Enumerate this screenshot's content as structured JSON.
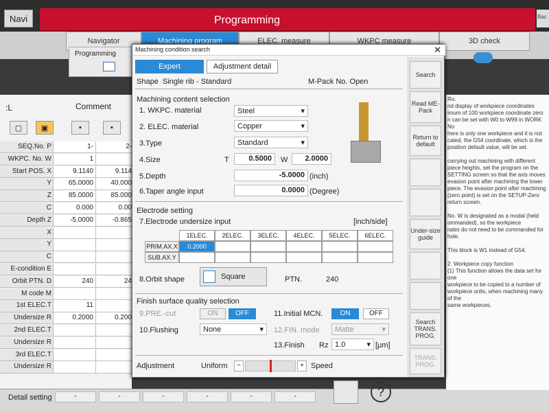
{
  "topbar": {
    "navi": "Navi",
    "title": "Programming",
    "right_stub": "Bac"
  },
  "tabs": [
    "Navigator",
    "Machining program",
    "ELEC. measure",
    "WKPC measure",
    "3D check"
  ],
  "prog_box": "Programming",
  "left": {
    "l_label": ":L",
    "comment": "Comment",
    "rows": [
      {
        "lab": "SEQ.No. P",
        "c1": "1-",
        "c2": "2-"
      },
      {
        "lab": "WKPC. No. W",
        "c1": "1",
        "c2": ""
      },
      {
        "lab": "Start POS. X",
        "c1": "9.1140",
        "c2": "9.114"
      },
      {
        "lab": "Y",
        "c1": "65.0000",
        "c2": "40.000"
      },
      {
        "lab": "Z",
        "c1": "85.0000",
        "c2": "85.000"
      },
      {
        "lab": "C",
        "c1": "0.000",
        "c2": "0.00"
      },
      {
        "lab": "Depth  Z",
        "c1": "-5.0000",
        "c2": "-0.865"
      },
      {
        "lab": "X",
        "c1": "",
        "c2": ""
      },
      {
        "lab": "Y",
        "c1": "",
        "c2": ""
      },
      {
        "lab": "C",
        "c1": "",
        "c2": ""
      },
      {
        "lab": "E-condition E",
        "c1": "",
        "c2": ""
      },
      {
        "lab": "Orbit PTN. D",
        "c1": "240",
        "c2": "24"
      },
      {
        "lab": "M code  M",
        "c1": "",
        "c2": ""
      },
      {
        "lab": "1st ELEC.T",
        "c1": "11",
        "c2": ""
      },
      {
        "lab": "Undersize R",
        "c1": "0.2000",
        "c2": "0.200"
      },
      {
        "lab": "2nd ELEC.T",
        "c1": "",
        "c2": ""
      },
      {
        "lab": "Undersize R",
        "c1": "",
        "c2": ""
      },
      {
        "lab": "3rd ELEC.T",
        "c1": "",
        "c2": ""
      },
      {
        "lab": "Undersize R",
        "c1": "",
        "c2": ""
      }
    ],
    "detail": "Detail setting"
  },
  "dialog": {
    "title": "Machining condition search",
    "tab_expert": "Expert",
    "tab_adjust": "Adjustment detail",
    "shape_label": "Shape",
    "shape_value": "Single rib - Standard",
    "mpack": "M-Pack No. Open",
    "mcs_title": "Machining content selection",
    "wkpc_label": "1. WKPC. material",
    "wkpc_value": "Steel",
    "elec_label": "2. ELEC. material",
    "elec_value": "Copper",
    "type_label": "3.Type",
    "type_value": "Standard",
    "size_label": "4.Size",
    "t_label": "T",
    "t_value": "0.5000",
    "w_label": "W",
    "w_value": "2.0000",
    "depth_label": "5.Depth",
    "depth_value": "-5.0000",
    "depth_unit": "(inch)",
    "taper_label": "6.Taper angle input",
    "taper_value": "0.0000",
    "taper_unit": "(Degree)",
    "es_title": "Electrode setting",
    "eu_label": "7.Electrode undersize input",
    "eu_unit": "[inch/side]",
    "elec_cols": [
      "1ELEC.",
      "2ELEC.",
      "3ELEC.",
      "4ELEC.",
      "5ELEC.",
      "6ELEC."
    ],
    "prim_label": "PRIM.AX.X",
    "prim_val": "0.2000",
    "sub_label": "SUB.AX.Y",
    "orbit_label": "8.Orbit shape",
    "orbit_btn": "Square",
    "ptn_label": "PTN.",
    "ptn_value": "240",
    "fsq_title": "Finish surface quality selection",
    "pre_label": "9.PRE.-cut",
    "on": "ON",
    "off": "OFF",
    "init_label": "11.Initial MCN.",
    "flush_label": "10.Flushing",
    "flush_value": "None",
    "finmode_label": "12.FIN. mode",
    "finmode_value": "Matte",
    "finish_label": "13.Finish",
    "rz": "Rz",
    "finish_value": "1.0",
    "finish_unit": "[μm]",
    "adj_label": "Adjustment",
    "adj_mode": "Uniform",
    "adj_speed": "Speed",
    "minus": "−",
    "plus": "+",
    "side": {
      "search": "Search",
      "read": "Read ME-Pack",
      "return": "Return to default",
      "undersize": "Under-size guide",
      "search_trans": "Search TRANS. PROG.",
      "trans": "TRANS. PROG."
    }
  },
  "right_text": "Ro.\nnd display of workpiece coordinates\nimum of 100 workpiece coordinate zero\nn can be set with W0 to W99 in WORK No\nhere is only one workpiece and it is not\ncated, the G54 coordinate, which is the\nposition default value, will be set.\n\ncarrying out machining with different\npiece heights, set the program on the\nSETTING screen so that the axis moves\nevasion point after machining the lower\npiece. The evasion point after machining\n(zero point) is set on the SETUP-Zero\nreturn screen.\n\nNo. W is designated as a modal (held\nommanded), so the workpiece\nrates do not need to be commanded for\nhole.\n\nThis block is W1 instead of G54.\n\n2. Workpiece copy function\n(1) This function allows the data set for one\nworkpiece to be copied to a number of\nworkpiece units, when machining many of the\nsame workpieces."
}
